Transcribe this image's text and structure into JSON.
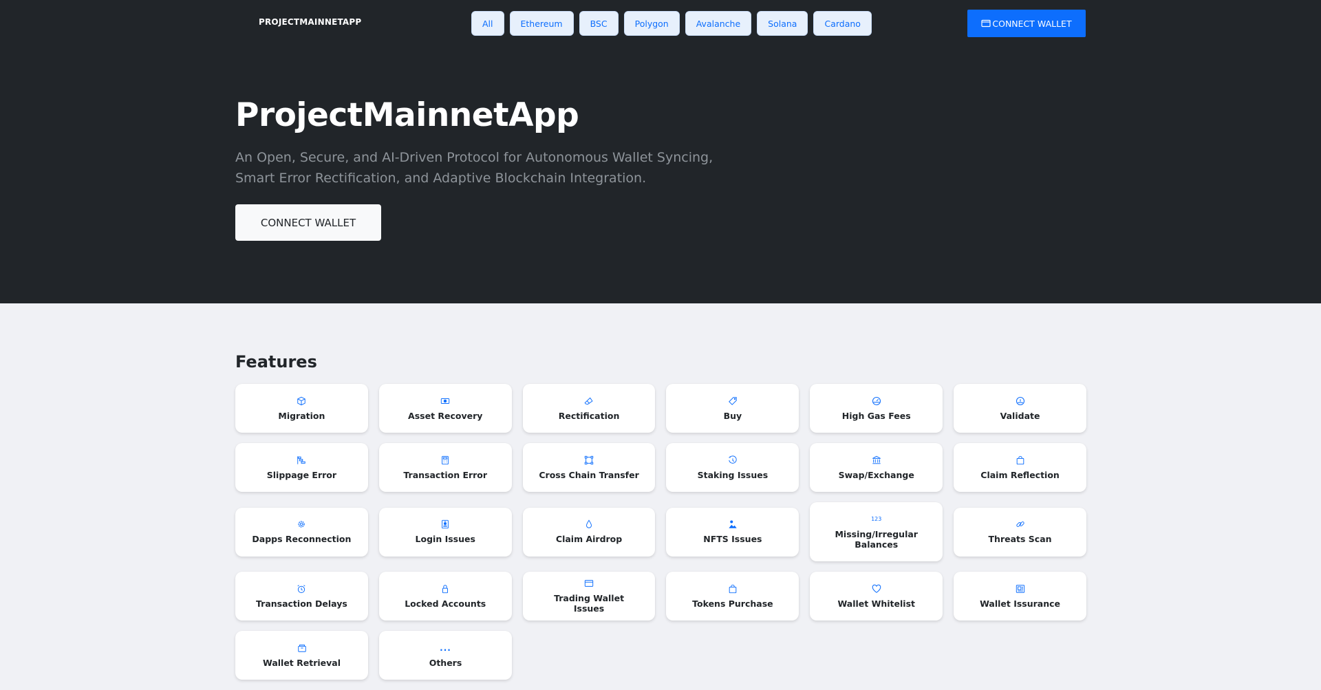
{
  "navbar": {
    "brand": "PROJECTMAINNETAPP",
    "chains": [
      "All",
      "Ethereum",
      "BSC",
      "Polygon",
      "Avalanche",
      "Solana",
      "Cardano"
    ],
    "connect_label": "CONNECT WALLET"
  },
  "hero": {
    "title": "ProjectMainnetApp",
    "subtitle": "An Open, Secure, and AI-Driven Protocol for Autonomous Wallet Syncing, Smart Error Rectification, and Adaptive Blockchain Integration.",
    "connect_label": "CONNECT WALLET"
  },
  "features": {
    "title": "Features",
    "items": [
      {
        "label": "Migration",
        "icon": "box-icon"
      },
      {
        "label": "Asset Recovery",
        "icon": "cash-icon"
      },
      {
        "label": "Rectification",
        "icon": "eraser-icon"
      },
      {
        "label": "Buy",
        "icon": "tag-icon"
      },
      {
        "label": "High Gas Fees",
        "icon": "speedometer-icon"
      },
      {
        "label": "Validate",
        "icon": "gauge-icon"
      },
      {
        "label": "Slippage Error",
        "icon": "bar-steps-icon"
      },
      {
        "label": "Transaction Error",
        "icon": "calculator-icon"
      },
      {
        "label": "Cross Chain Transfer",
        "icon": "bounding-box-icon"
      },
      {
        "label": "Staking Issues",
        "icon": "clock-history-icon"
      },
      {
        "label": "Swap/Exchange",
        "icon": "bank-icon"
      },
      {
        "label": "Claim Reflection",
        "icon": "bag-icon"
      },
      {
        "label": "Dapps Reconnection",
        "icon": "gear-icon"
      },
      {
        "label": "Login Issues",
        "icon": "person-badge-icon"
      },
      {
        "label": "Claim Airdrop",
        "icon": "droplet-icon"
      },
      {
        "label": "NFTS Issues",
        "icon": "image-person-icon"
      },
      {
        "label": "Missing/Irregular Balances",
        "icon": "numbers-icon",
        "icon_text": "123"
      },
      {
        "label": "Threats Scan",
        "icon": "link-icon"
      },
      {
        "label": "Transaction Delays",
        "icon": "alarm-icon"
      },
      {
        "label": "Locked Accounts",
        "icon": "lock-icon"
      },
      {
        "label": "Trading Wallet Issues",
        "icon": "wallet-icon"
      },
      {
        "label": "Tokens Purchase",
        "icon": "shopping-bag-icon"
      },
      {
        "label": "Wallet Whitelist",
        "icon": "heart-icon"
      },
      {
        "label": "Wallet Issurance",
        "icon": "receipt-icon"
      },
      {
        "label": "Wallet Retrieval",
        "icon": "archive-icon"
      },
      {
        "label": "Others",
        "icon": "three-dots-icon",
        "icon_text": "..."
      }
    ]
  },
  "colors": {
    "hero_bg": "#212529",
    "accent": "#0d6efd",
    "page_bg": "#f0f1f5"
  }
}
